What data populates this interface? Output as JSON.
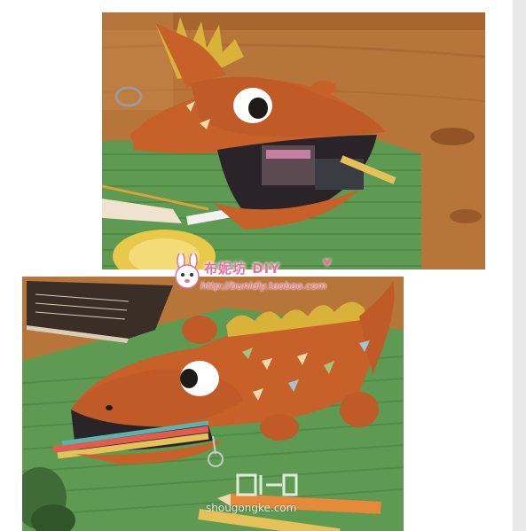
{
  "watermark": {
    "brand": "布妮坊 DIY",
    "url": "http://bunidiy.taobao.com",
    "site": "shougongke.com"
  },
  "colors": {
    "felt_orange": "#c8602a",
    "felt_yellow": "#d9b23a",
    "mat_green": "#5f9a52",
    "table_wood": "#b8753a",
    "brand_pink": "#e8709f"
  },
  "icons": {
    "mascot": "bunny-mascot-icon",
    "heart": "heart-icon"
  }
}
